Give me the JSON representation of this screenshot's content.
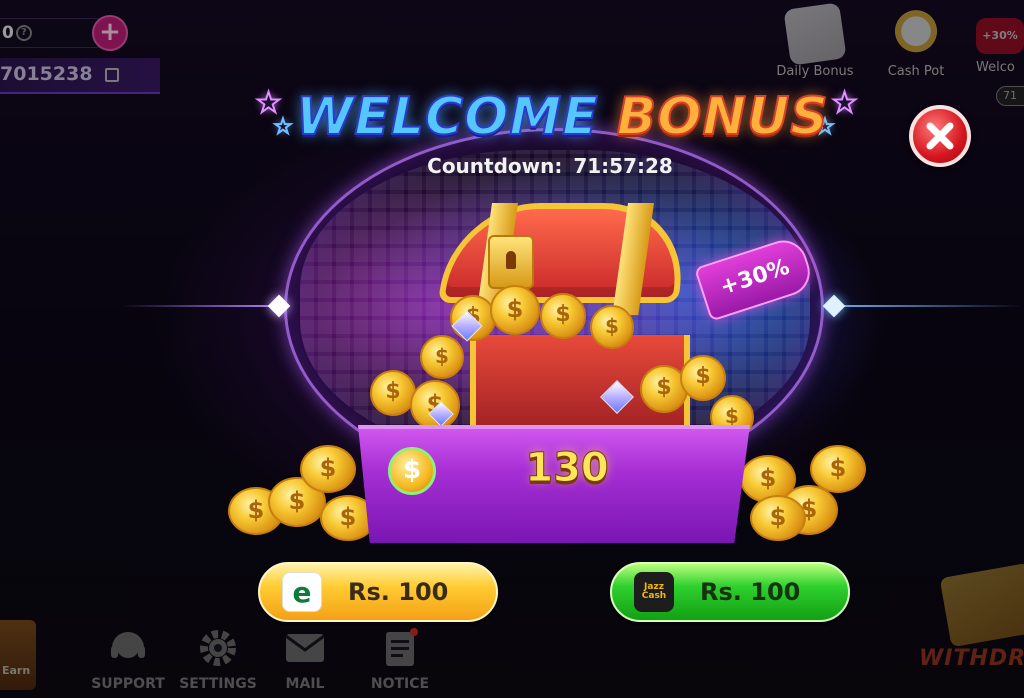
{
  "hud": {
    "balance": "0",
    "player_id": "7015238"
  },
  "shortcuts": [
    {
      "label": "Daily Bonus"
    },
    {
      "label": "Cash Pot"
    },
    {
      "label": "Welco",
      "badge": "71"
    }
  ],
  "bottom_nav": {
    "earn_label": "Earn",
    "support": "SUPPORT",
    "settings": "SETTINGS",
    "mail": "MAIL",
    "notice": "NOTICE",
    "withdraw": "WITHDR"
  },
  "modal": {
    "title_part1": "WELCOME",
    "title_part2": "BONUS",
    "countdown_label": "Countdown:",
    "countdown_value": "71:57:28",
    "bonus_percent": "+30%",
    "coin_amount": "130",
    "coin_symbol": "$",
    "payment_options": [
      {
        "provider_icon": "easypaisa-logo",
        "logo_text": "e",
        "label": "Rs. 100",
        "color": "#ffcc33"
      },
      {
        "provider_icon": "jazzcash-logo",
        "logo_text": "Jazz Cash",
        "label": "Rs. 100",
        "color": "#2ed02e"
      }
    ]
  },
  "colors": {
    "accent_blue": "#56c6ff",
    "accent_orange": "#ffb13c",
    "purple_tray": "#a52ed4",
    "close_red": "#d4161e"
  }
}
